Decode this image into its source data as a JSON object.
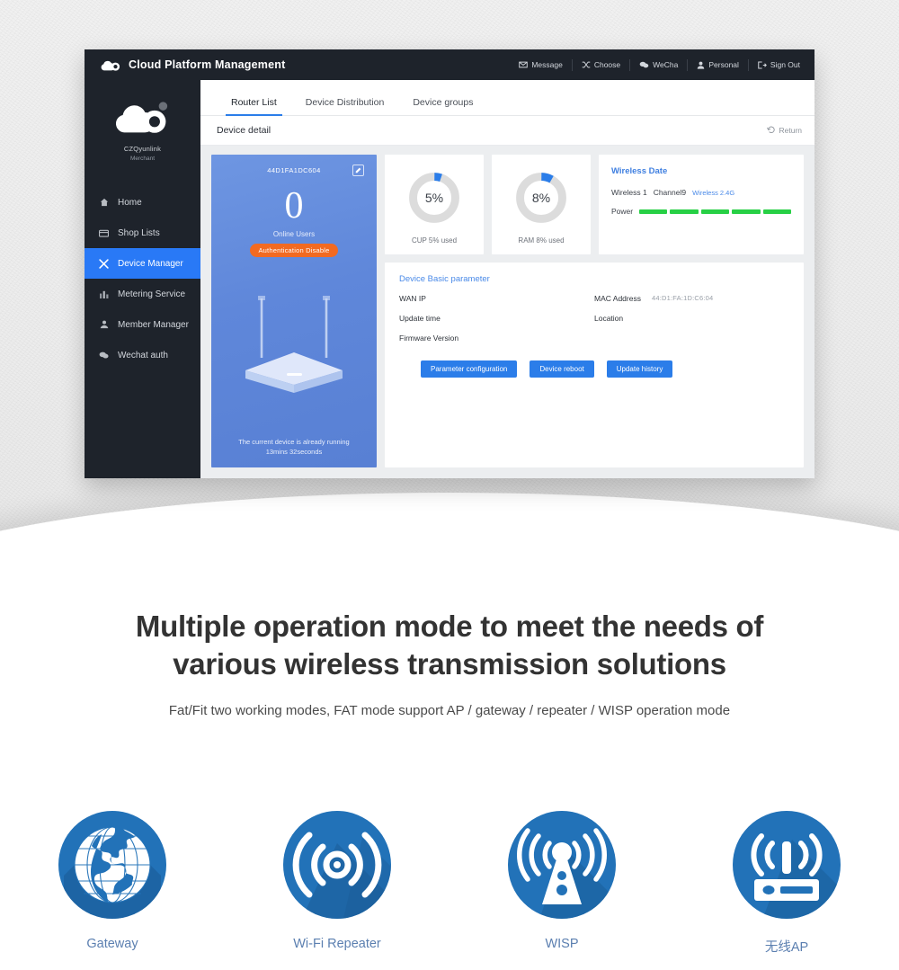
{
  "topbar": {
    "logo_icon": "cloud-logo-icon",
    "title": "Cloud Platform Management",
    "nav": [
      {
        "label": "Message",
        "icon": "envelope-icon"
      },
      {
        "label": "Choose",
        "icon": "shuffle-icon"
      },
      {
        "label": "WeCha",
        "icon": "wechat-icon"
      },
      {
        "label": "Personal",
        "icon": "user-icon"
      },
      {
        "label": "Sign Out",
        "icon": "sign-out-icon"
      }
    ]
  },
  "sidebar": {
    "logo_icon": "cloud-logo-icon",
    "user_name": "CZQyunlink",
    "user_role": "Merchant",
    "items": [
      {
        "label": "Home",
        "icon": "home-icon",
        "active": false
      },
      {
        "label": "Shop Lists",
        "icon": "shop-icon",
        "active": false
      },
      {
        "label": "Device Manager",
        "icon": "wrench-icon",
        "active": true
      },
      {
        "label": "Metering Service",
        "icon": "chart-icon",
        "active": false
      },
      {
        "label": "Member Manager",
        "icon": "member-icon",
        "active": false
      },
      {
        "label": "Wechat auth",
        "icon": "chat-icon",
        "active": false
      }
    ]
  },
  "tabs": [
    {
      "label": "Router List",
      "active": true
    },
    {
      "label": "Device Distribution",
      "active": false
    },
    {
      "label": "Device groups",
      "active": false
    }
  ],
  "panel": {
    "title": "Device detail",
    "return_label": "Return",
    "return_icon": "undo-icon"
  },
  "device_card": {
    "mac": "44D1FA1DC604",
    "edit_icon": "edit-square-icon",
    "online_count": "0",
    "online_label": "Online Users",
    "badge": "Authentication Disable",
    "router_icon": "router-illustration",
    "uptime_line1": "The current device is already running",
    "uptime_line2": "13mins 32seconds"
  },
  "stats": [
    {
      "value": "5%",
      "percent": 5,
      "label": "CUP 5% used",
      "name": "cpu"
    },
    {
      "value": "8%",
      "percent": 8,
      "label": "RAM 8% used",
      "name": "ram"
    }
  ],
  "wireless": {
    "title": "Wireless Date",
    "radio": "Wireless 1",
    "channel": "Channel9",
    "band": "Wireless 2.4G",
    "power_label": "Power",
    "power_bars": 5,
    "power_color": "#27d045"
  },
  "basic": {
    "title": "Device Basic parameter",
    "left_rows": [
      {
        "label": "WAN IP",
        "value": ""
      },
      {
        "label": "Update time",
        "value": ""
      },
      {
        "label": "Firmware Version",
        "value": ""
      }
    ],
    "right_rows": [
      {
        "label": "MAC Address",
        "value": "44:D1:FA:1D:C6:04"
      },
      {
        "label": "Location",
        "value": ""
      }
    ],
    "buttons": [
      {
        "label": "Parameter configuration"
      },
      {
        "label": "Device reboot"
      },
      {
        "label": "Update history"
      }
    ]
  },
  "marketing": {
    "headline_line1": "Multiple operation mode to meet the needs of",
    "headline_line2": "various wireless transmission solutions",
    "subhead": "Fat/Fit two working modes, FAT mode support AP / gateway / repeater / WISP operation mode",
    "modes": [
      {
        "label": "Gateway",
        "icon": "globe-icon"
      },
      {
        "label": "Wi-Fi Repeater",
        "icon": "wifi-signal-icon"
      },
      {
        "label": "WISP",
        "icon": "antenna-tower-icon"
      },
      {
        "label": "无线AP",
        "icon": "wireless-router-icon"
      }
    ]
  },
  "colors": {
    "accent_blue": "#2b7de9",
    "dark_chrome": "#1e232b",
    "badge_orange": "#f26a21",
    "power_green": "#27d045",
    "icon_blue": "#2272b8",
    "label_blue": "#5b7fb0"
  }
}
